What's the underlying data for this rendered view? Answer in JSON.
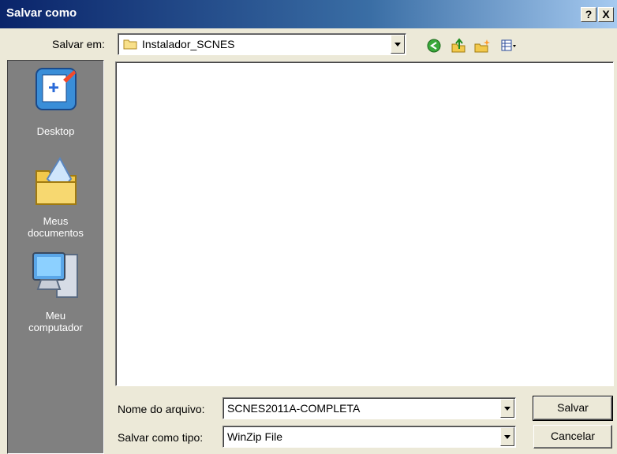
{
  "window": {
    "title": "Salvar como",
    "help_glyph": "?",
    "close_glyph": "X"
  },
  "savein": {
    "label": "Salvar em:",
    "value": "Instalador_SCNES",
    "icons": [
      "back-icon",
      "up-folder-icon",
      "new-folder-icon",
      "views-menu-icon"
    ]
  },
  "places": [
    {
      "label": "Desktop",
      "icon": "desktop-icon"
    },
    {
      "label": "Meus documentos",
      "line1": "Meus",
      "line2": "documentos",
      "icon": "my-documents-icon"
    },
    {
      "label": "Meu computador",
      "line1": "Meu",
      "line2": "computador",
      "icon": "my-computer-icon"
    }
  ],
  "filename": {
    "label": "Nome do arquivo:",
    "value": "SCNES2011A-COMPLETA"
  },
  "filetype": {
    "label": "Salvar como tipo:",
    "value": "WinZip File"
  },
  "buttons": {
    "save": "Salvar",
    "cancel": "Cancelar"
  },
  "colors": {
    "title_bar_start": "#0a246a",
    "title_bar_end": "#a6caf0",
    "places_bg": "#808080",
    "dialog_bg": "#ece9d8"
  }
}
